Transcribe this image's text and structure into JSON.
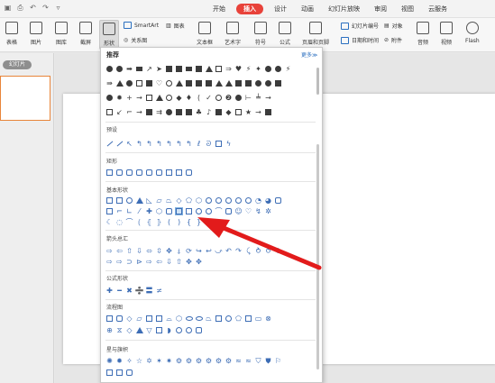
{
  "quick_access": [
    "save-icon",
    "print-icon",
    "undo-icon",
    "redo-icon"
  ],
  "menu": [
    "开始",
    "插入",
    "设计",
    "动画",
    "幻灯片放映",
    "审阅",
    "视图",
    "云服务"
  ],
  "active_menu": "插入",
  "ribbon": {
    "table": "表格",
    "picture": "图片",
    "gallery": "图库",
    "screenshot": "截屏",
    "shape": "形状",
    "smartart": "SmartArt",
    "chart": "图表",
    "relation": "关系图",
    "textbox": "文本框",
    "wordart": "艺术字",
    "symbol": "符号",
    "formula": "公式",
    "header_footer": "页眉和页脚",
    "slide_number": "幻灯片编号",
    "object": "对象",
    "datetime": "日期和时间",
    "attachment": "附件",
    "audio": "音频",
    "video": "视频",
    "flash": "Flash"
  },
  "panel_tab": "幻灯片",
  "dropdown": {
    "recommended": "推荐",
    "more": "更多≫",
    "sections": [
      "预设",
      "矩形",
      "基本形状",
      "箭头总汇",
      "公式形状",
      "流程图",
      "星与旗帜"
    ]
  },
  "colors": {
    "accent": "#e8423a",
    "shape_outline": "#3d6db5",
    "highlight": "#cfe3f6",
    "arrow": "#e21b1b"
  }
}
